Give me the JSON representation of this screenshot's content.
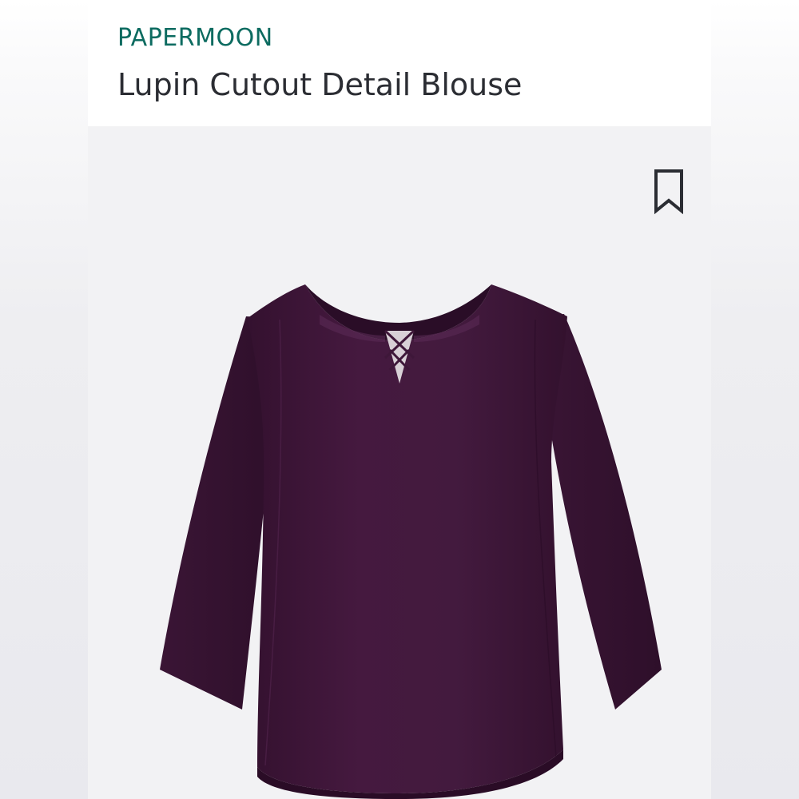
{
  "product": {
    "brand": "PAPERMOON",
    "name": "Lupin Cutout Detail Blouse"
  },
  "icons": {
    "save": "bookmark-icon"
  },
  "colors": {
    "brand": "#0c6b60",
    "title": "#2b2d33",
    "garment": "#3e1739",
    "background": "#f2f2f4"
  }
}
